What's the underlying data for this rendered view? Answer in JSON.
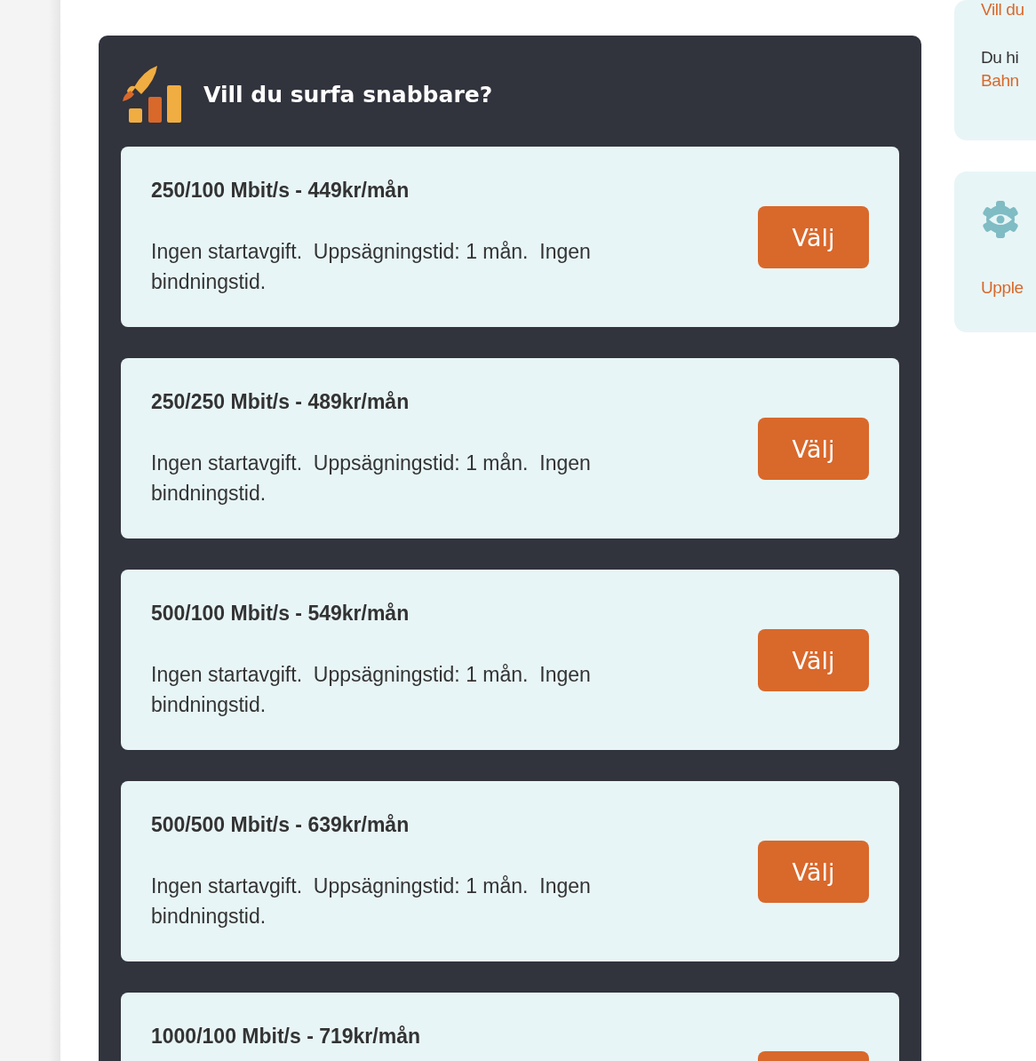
{
  "offer": {
    "title": "Vill du surfa snabbare?",
    "plans": [
      {
        "name": "250/100 Mbit/s - 449kr/mån",
        "description": "Ingen startavgift.  Uppsägningstid: 1 mån.  Ingen bindningstid.",
        "button": "Välj"
      },
      {
        "name": "250/250 Mbit/s - 489kr/mån",
        "description": "Ingen startavgift.  Uppsägningstid: 1 mån.  Ingen bindningstid.",
        "button": "Välj"
      },
      {
        "name": "500/100 Mbit/s - 549kr/mån",
        "description": "Ingen startavgift.  Uppsägningstid: 1 mån.  Ingen bindningstid.",
        "button": "Välj"
      },
      {
        "name": "500/500 Mbit/s - 639kr/mån",
        "description": "Ingen startavgift.  Uppsägningstid: 1 mån.  Ingen bindningstid.",
        "button": "Välj"
      },
      {
        "name": "1000/100 Mbit/s - 719kr/mån"
      }
    ]
  },
  "sidebar": [
    {
      "kind": "text",
      "heading": "Vill du",
      "text": "Du hi",
      "link": "Bahn"
    },
    {
      "kind": "icon",
      "link": "Upple"
    }
  ]
}
